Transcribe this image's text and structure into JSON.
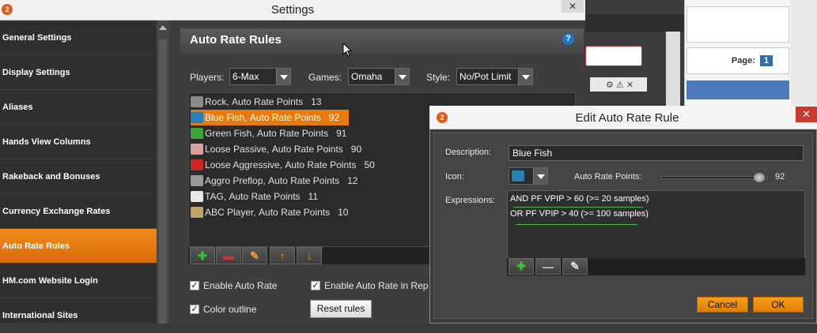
{
  "settings": {
    "title": "Settings",
    "close": "✕"
  },
  "sidebar": {
    "items": [
      {
        "label": "General Settings"
      },
      {
        "label": "Display Settings"
      },
      {
        "label": "Aliases"
      },
      {
        "label": "Hands View Columns"
      },
      {
        "label": "Rakeback and Bonuses"
      },
      {
        "label": "Currency Exchange Rates"
      },
      {
        "label": "Auto Rate Rules",
        "active": true
      },
      {
        "label": "HM.com Website Login"
      },
      {
        "label": "International Sites"
      }
    ]
  },
  "auto_rate": {
    "title": "Auto Rate Rules",
    "help": "?",
    "players_label": "Players:",
    "players_value": "6-Max",
    "games_label": "Games:",
    "games_value": "Omaha",
    "style_label": "Style:",
    "style_value": "No/Pot Limit",
    "rules": [
      {
        "name": "Rock,",
        "points_label": "Auto Rate Points",
        "points": "13",
        "icon_color": "#888888"
      },
      {
        "name": "Blue Fish,",
        "points_label": "Auto Rate Points",
        "points": "92",
        "icon_color": "#2a7fb5",
        "selected": true
      },
      {
        "name": "Green Fish,",
        "points_label": "Auto Rate Points",
        "points": "91",
        "icon_color": "#3da33a"
      },
      {
        "name": "Loose Passive,",
        "points_label": "Auto Rate Points",
        "points": "90",
        "icon_color": "#d9a0a0"
      },
      {
        "name": "Loose Aggressive,",
        "points_label": "Auto Rate Points",
        "points": "50",
        "icon_color": "#d02424"
      },
      {
        "name": "Aggro Preflop,",
        "points_label": "Auto Rate Points",
        "points": "12",
        "icon_color": "#9a9a9a"
      },
      {
        "name": "TAG,",
        "points_label": "Auto Rate Points",
        "points": "11",
        "icon_color": "#e8e8e8"
      },
      {
        "name": "ABC Player,",
        "points_label": "Auto Rate Points",
        "points": "10",
        "icon_color": "#c0a46a"
      }
    ],
    "toolbar": {
      "add": "✚",
      "remove": "▬",
      "edit": "✎",
      "up": "↑",
      "down": "↓"
    },
    "enable_auto_rate": "Enable Auto Rate",
    "enable_auto_rate_rep": "Enable Auto Rate in Rep",
    "color_outline": "Color outline",
    "reset_rules": "Reset rules",
    "check": "✓"
  },
  "background": {
    "page_label": "Page:",
    "page_number": "1",
    "mini_icons": "⚙ ⚠ ✕"
  },
  "edit_dialog": {
    "title": "Edit Auto Rate Rule",
    "close": "✕",
    "description_label": "Description:",
    "description_value": "Blue Fish",
    "icon_label": "Icon:",
    "points_label": "Auto Rate Points:",
    "points_value": "92",
    "points_fraction": 0.92,
    "expressions_label": "Expressions:",
    "expressions": [
      "AND PF VPIP > 60 (>= 20 samples)",
      "OR PF VPIP > 40 (>= 100 samples)"
    ],
    "toolbar": {
      "add": "✚",
      "remove": "—",
      "edit": "✎"
    },
    "cancel": "Cancel",
    "ok": "OK"
  },
  "colors": {
    "accent_orange": "#e67a0e",
    "dark_bg": "#3d3d3d",
    "underline_green": "#3fbf38"
  }
}
